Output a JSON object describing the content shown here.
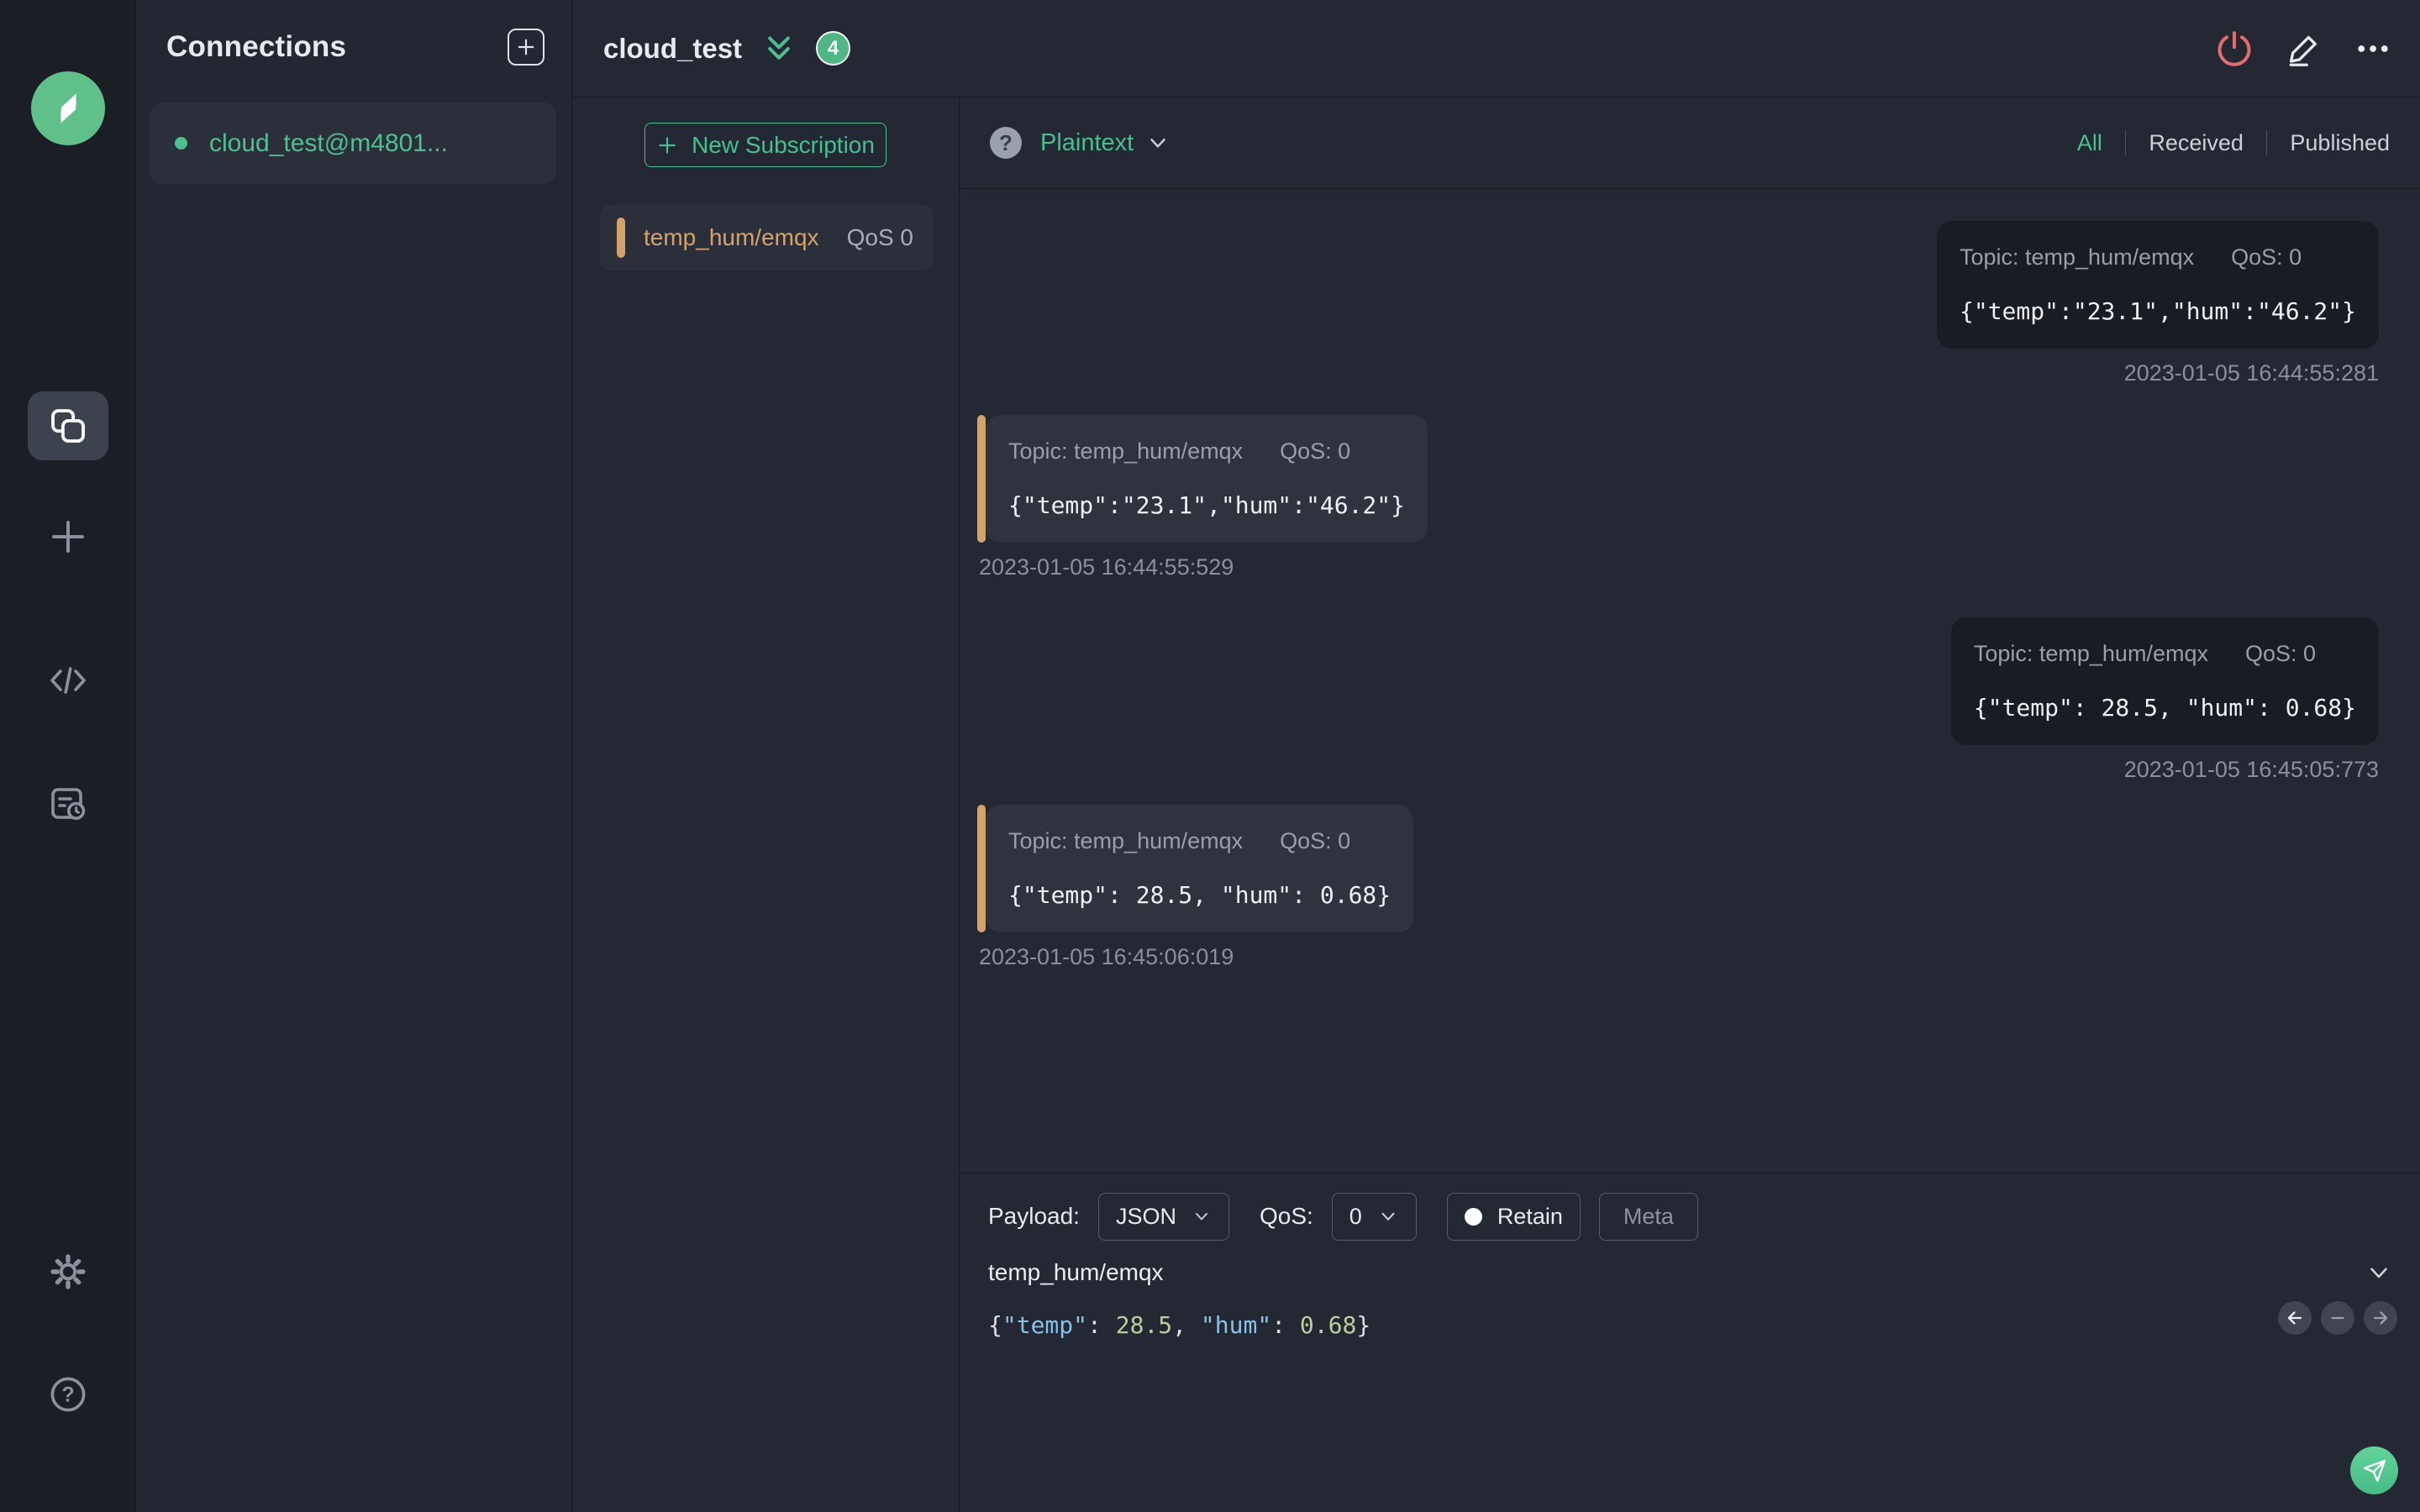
{
  "colors": {
    "accent_green": "#42c28c",
    "subscription_accent": "#d2a36b",
    "disconnect_red": "#e36d6d"
  },
  "connections": {
    "title": "Connections",
    "item": {
      "label": "cloud_test@m4801...",
      "status": "connected"
    }
  },
  "header": {
    "title": "cloud_test",
    "badge_count": "4"
  },
  "subscriptions": {
    "new_button_label": "New Subscription",
    "items": [
      {
        "topic": "temp_hum/emqx",
        "qos": "QoS 0"
      }
    ]
  },
  "msgbar": {
    "format": "Plaintext",
    "help": "?",
    "tabs": {
      "all": "All",
      "received": "Received",
      "published": "Published"
    },
    "active_tab": "All"
  },
  "messages": [
    {
      "direction": "published",
      "topic_label": "Topic: temp_hum/emqx",
      "qos_label": "QoS: 0",
      "payload": "{\"temp\":\"23.1\",\"hum\":\"46.2\"}",
      "timestamp": "2023-01-05 16:44:55:281"
    },
    {
      "direction": "received",
      "topic_label": "Topic: temp_hum/emqx",
      "qos_label": "QoS: 0",
      "payload": "{\"temp\":\"23.1\",\"hum\":\"46.2\"}",
      "timestamp": "2023-01-05 16:44:55:529"
    },
    {
      "direction": "published",
      "topic_label": "Topic: temp_hum/emqx",
      "qos_label": "QoS: 0",
      "payload": "{\"temp\": 28.5, \"hum\": 0.68}",
      "timestamp": "2023-01-05 16:45:05:773"
    },
    {
      "direction": "received",
      "topic_label": "Topic: temp_hum/emqx",
      "qos_label": "QoS: 0",
      "payload": "{\"temp\": 28.5, \"hum\": 0.68}",
      "timestamp": "2023-01-05 16:45:06:019"
    }
  ],
  "publish": {
    "payload_label": "Payload:",
    "payload_format": "JSON",
    "qos_label": "QoS:",
    "qos_value": "0",
    "retain_label": "Retain",
    "meta_label": "Meta",
    "topic": "temp_hum/emqx",
    "editor_tokens": {
      "open": "{",
      "key1": "\"temp\"",
      "sep1": ": ",
      "num1": "28.5",
      "comma": ", ",
      "key2": "\"hum\"",
      "sep2": ": ",
      "num2": "0.68",
      "close": "}"
    }
  }
}
